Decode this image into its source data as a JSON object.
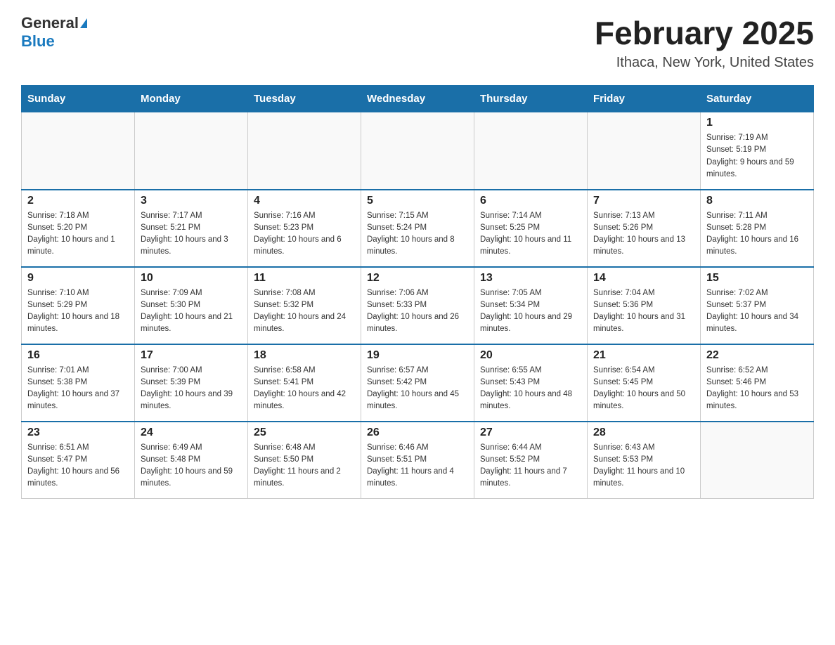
{
  "header": {
    "logo_general": "General",
    "logo_blue": "Blue",
    "title": "February 2025",
    "subtitle": "Ithaca, New York, United States"
  },
  "days_of_week": [
    "Sunday",
    "Monday",
    "Tuesday",
    "Wednesday",
    "Thursday",
    "Friday",
    "Saturday"
  ],
  "weeks": [
    [
      {
        "day": "",
        "sunrise": "",
        "sunset": "",
        "daylight": ""
      },
      {
        "day": "",
        "sunrise": "",
        "sunset": "",
        "daylight": ""
      },
      {
        "day": "",
        "sunrise": "",
        "sunset": "",
        "daylight": ""
      },
      {
        "day": "",
        "sunrise": "",
        "sunset": "",
        "daylight": ""
      },
      {
        "day": "",
        "sunrise": "",
        "sunset": "",
        "daylight": ""
      },
      {
        "day": "",
        "sunrise": "",
        "sunset": "",
        "daylight": ""
      },
      {
        "day": "1",
        "sunrise": "Sunrise: 7:19 AM",
        "sunset": "Sunset: 5:19 PM",
        "daylight": "Daylight: 9 hours and 59 minutes."
      }
    ],
    [
      {
        "day": "2",
        "sunrise": "Sunrise: 7:18 AM",
        "sunset": "Sunset: 5:20 PM",
        "daylight": "Daylight: 10 hours and 1 minute."
      },
      {
        "day": "3",
        "sunrise": "Sunrise: 7:17 AM",
        "sunset": "Sunset: 5:21 PM",
        "daylight": "Daylight: 10 hours and 3 minutes."
      },
      {
        "day": "4",
        "sunrise": "Sunrise: 7:16 AM",
        "sunset": "Sunset: 5:23 PM",
        "daylight": "Daylight: 10 hours and 6 minutes."
      },
      {
        "day": "5",
        "sunrise": "Sunrise: 7:15 AM",
        "sunset": "Sunset: 5:24 PM",
        "daylight": "Daylight: 10 hours and 8 minutes."
      },
      {
        "day": "6",
        "sunrise": "Sunrise: 7:14 AM",
        "sunset": "Sunset: 5:25 PM",
        "daylight": "Daylight: 10 hours and 11 minutes."
      },
      {
        "day": "7",
        "sunrise": "Sunrise: 7:13 AM",
        "sunset": "Sunset: 5:26 PM",
        "daylight": "Daylight: 10 hours and 13 minutes."
      },
      {
        "day": "8",
        "sunrise": "Sunrise: 7:11 AM",
        "sunset": "Sunset: 5:28 PM",
        "daylight": "Daylight: 10 hours and 16 minutes."
      }
    ],
    [
      {
        "day": "9",
        "sunrise": "Sunrise: 7:10 AM",
        "sunset": "Sunset: 5:29 PM",
        "daylight": "Daylight: 10 hours and 18 minutes."
      },
      {
        "day": "10",
        "sunrise": "Sunrise: 7:09 AM",
        "sunset": "Sunset: 5:30 PM",
        "daylight": "Daylight: 10 hours and 21 minutes."
      },
      {
        "day": "11",
        "sunrise": "Sunrise: 7:08 AM",
        "sunset": "Sunset: 5:32 PM",
        "daylight": "Daylight: 10 hours and 24 minutes."
      },
      {
        "day": "12",
        "sunrise": "Sunrise: 7:06 AM",
        "sunset": "Sunset: 5:33 PM",
        "daylight": "Daylight: 10 hours and 26 minutes."
      },
      {
        "day": "13",
        "sunrise": "Sunrise: 7:05 AM",
        "sunset": "Sunset: 5:34 PM",
        "daylight": "Daylight: 10 hours and 29 minutes."
      },
      {
        "day": "14",
        "sunrise": "Sunrise: 7:04 AM",
        "sunset": "Sunset: 5:36 PM",
        "daylight": "Daylight: 10 hours and 31 minutes."
      },
      {
        "day": "15",
        "sunrise": "Sunrise: 7:02 AM",
        "sunset": "Sunset: 5:37 PM",
        "daylight": "Daylight: 10 hours and 34 minutes."
      }
    ],
    [
      {
        "day": "16",
        "sunrise": "Sunrise: 7:01 AM",
        "sunset": "Sunset: 5:38 PM",
        "daylight": "Daylight: 10 hours and 37 minutes."
      },
      {
        "day": "17",
        "sunrise": "Sunrise: 7:00 AM",
        "sunset": "Sunset: 5:39 PM",
        "daylight": "Daylight: 10 hours and 39 minutes."
      },
      {
        "day": "18",
        "sunrise": "Sunrise: 6:58 AM",
        "sunset": "Sunset: 5:41 PM",
        "daylight": "Daylight: 10 hours and 42 minutes."
      },
      {
        "day": "19",
        "sunrise": "Sunrise: 6:57 AM",
        "sunset": "Sunset: 5:42 PM",
        "daylight": "Daylight: 10 hours and 45 minutes."
      },
      {
        "day": "20",
        "sunrise": "Sunrise: 6:55 AM",
        "sunset": "Sunset: 5:43 PM",
        "daylight": "Daylight: 10 hours and 48 minutes."
      },
      {
        "day": "21",
        "sunrise": "Sunrise: 6:54 AM",
        "sunset": "Sunset: 5:45 PM",
        "daylight": "Daylight: 10 hours and 50 minutes."
      },
      {
        "day": "22",
        "sunrise": "Sunrise: 6:52 AM",
        "sunset": "Sunset: 5:46 PM",
        "daylight": "Daylight: 10 hours and 53 minutes."
      }
    ],
    [
      {
        "day": "23",
        "sunrise": "Sunrise: 6:51 AM",
        "sunset": "Sunset: 5:47 PM",
        "daylight": "Daylight: 10 hours and 56 minutes."
      },
      {
        "day": "24",
        "sunrise": "Sunrise: 6:49 AM",
        "sunset": "Sunset: 5:48 PM",
        "daylight": "Daylight: 10 hours and 59 minutes."
      },
      {
        "day": "25",
        "sunrise": "Sunrise: 6:48 AM",
        "sunset": "Sunset: 5:50 PM",
        "daylight": "Daylight: 11 hours and 2 minutes."
      },
      {
        "day": "26",
        "sunrise": "Sunrise: 6:46 AM",
        "sunset": "Sunset: 5:51 PM",
        "daylight": "Daylight: 11 hours and 4 minutes."
      },
      {
        "day": "27",
        "sunrise": "Sunrise: 6:44 AM",
        "sunset": "Sunset: 5:52 PM",
        "daylight": "Daylight: 11 hours and 7 minutes."
      },
      {
        "day": "28",
        "sunrise": "Sunrise: 6:43 AM",
        "sunset": "Sunset: 5:53 PM",
        "daylight": "Daylight: 11 hours and 10 minutes."
      },
      {
        "day": "",
        "sunrise": "",
        "sunset": "",
        "daylight": ""
      }
    ]
  ]
}
